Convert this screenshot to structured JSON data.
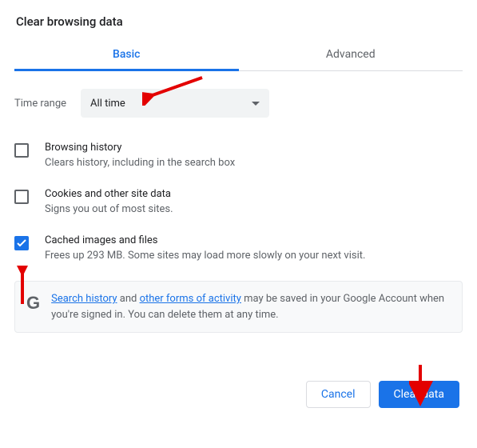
{
  "title": "Clear browsing data",
  "tabs": {
    "basic": "Basic",
    "advanced": "Advanced"
  },
  "timerange": {
    "label": "Time range",
    "selected": "All time"
  },
  "options": [
    {
      "name": "Browsing history",
      "desc": "Clears history, including in the search box",
      "checked": false
    },
    {
      "name": "Cookies and other site data",
      "desc": "Signs you out of most sites.",
      "checked": false
    },
    {
      "name": "Cached images and files",
      "desc": "Frees up 293 MB. Some sites may load more slowly on your next visit.",
      "checked": true
    }
  ],
  "notice": {
    "link1": "Search history",
    "mid1": " and ",
    "link2": "other forms of activity",
    "rest": " may be saved in your Google Account when you're signed in. You can delete them at any time."
  },
  "buttons": {
    "cancel": "Cancel",
    "confirm": "Clear data"
  }
}
